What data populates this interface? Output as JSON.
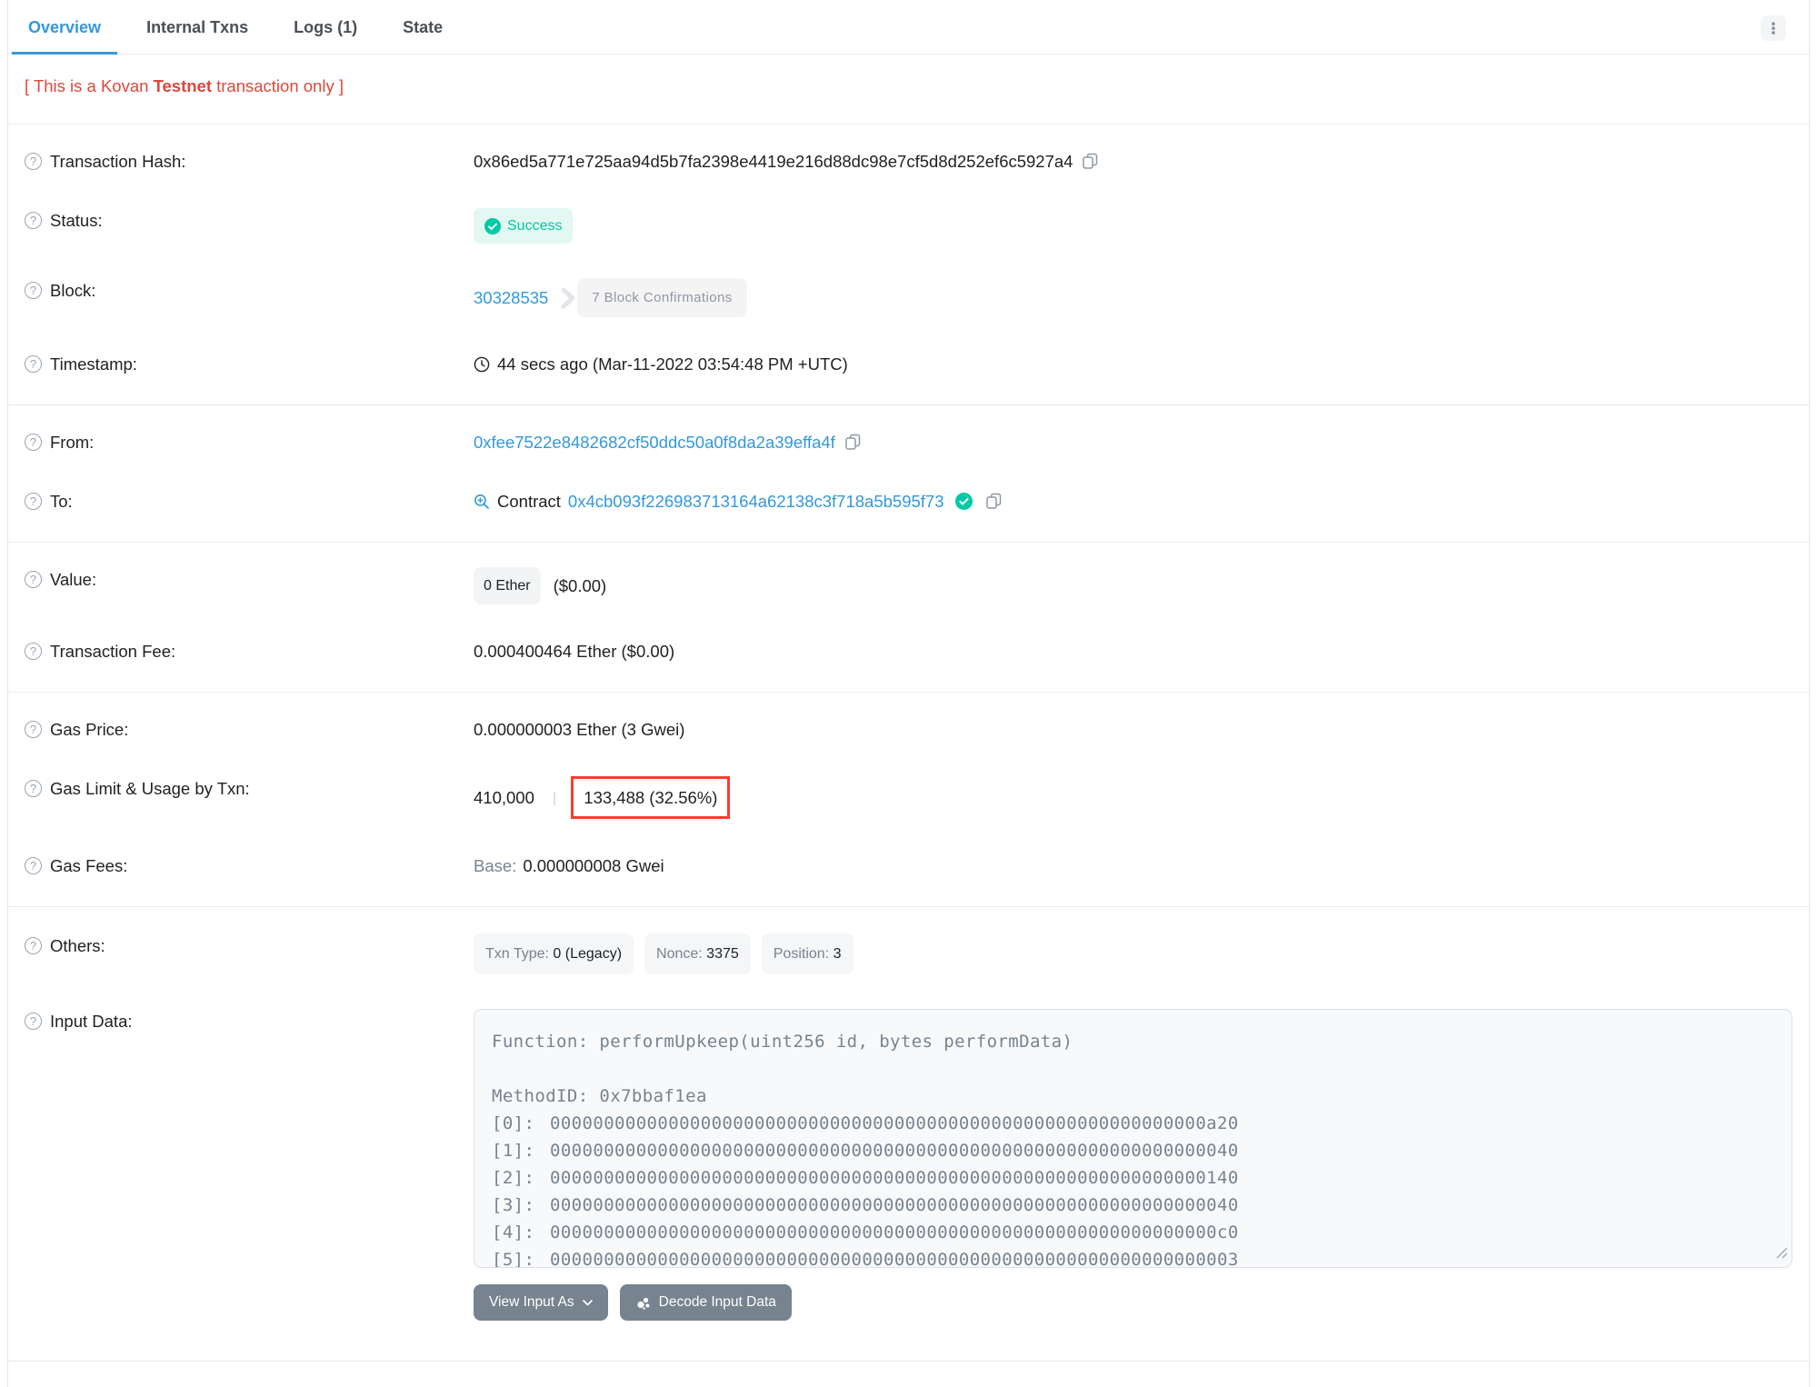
{
  "colors": {
    "accent_blue": "#3498db",
    "success_teal": "#00c9a7",
    "notice_red": "#e0473d",
    "highlight_red": "#ff3b30",
    "divider": "#e7eaf3",
    "muted": "#77838f"
  },
  "tabs": {
    "overview": "Overview",
    "internal": "Internal Txns",
    "logs": "Logs (1)",
    "state": "State"
  },
  "menu": {
    "kebab_glyph": "⋮"
  },
  "notice": {
    "part1": "[ This is a Kovan ",
    "bold": "Testnet",
    "part2": " transaction only ]"
  },
  "rows": {
    "hash": {
      "label": "Transaction Hash:",
      "value": "0x86ed5a771e725aa94d5b7fa2398e4419e216d88dc98e7cf5d8d252ef6c5927a4"
    },
    "status": {
      "label": "Status:",
      "badge": "Success",
      "check_glyph": "✓"
    },
    "block": {
      "label": "Block:",
      "number": "30328535",
      "confirmations": "7 Block Confirmations"
    },
    "timestamp": {
      "label": "Timestamp:",
      "value": "44 secs ago (Mar-11-2022 03:54:48 PM +UTC)"
    },
    "from": {
      "label": "From:",
      "address": "0xfee7522e8482682cf50ddc50a0f8da2a39effa4f"
    },
    "to": {
      "label": "To:",
      "kind": "Contract",
      "address": "0x4cb093f226983713164a62138c3f718a5b595f73",
      "check_glyph": "✓"
    },
    "value": {
      "label": "Value:",
      "amount": "0 Ether",
      "usd": "($0.00)"
    },
    "fee": {
      "label": "Transaction Fee:",
      "value": "0.000400464 Ether ($0.00)"
    },
    "gas_price": {
      "label": "Gas Price:",
      "value": "0.000000003 Ether (3 Gwei)"
    },
    "gas_limit": {
      "label": "Gas Limit & Usage by Txn:",
      "limit": "410,000",
      "separator": "|",
      "usage": "133,488 (32.56%)"
    },
    "gas_fees": {
      "label": "Gas Fees:",
      "base_label": "Base:",
      "base_value": "0.000000008 Gwei"
    },
    "others": {
      "label": "Others:",
      "txn_type_label": "Txn Type:",
      "txn_type_value": "0 (Legacy)",
      "nonce_label": "Nonce:",
      "nonce_value": "3375",
      "position_label": "Position:",
      "position_value": "3"
    },
    "input": {
      "label": "Input Data:",
      "function_line": "Function: performUpkeep(uint256 id, bytes performData)",
      "method_line": "MethodID: 0x7bbaf1ea",
      "params": [
        {
          "key": "[0]:",
          "value": "0000000000000000000000000000000000000000000000000000000000000a20"
        },
        {
          "key": "[1]:",
          "value": "0000000000000000000000000000000000000000000000000000000000000040"
        },
        {
          "key": "[2]:",
          "value": "0000000000000000000000000000000000000000000000000000000000000140"
        },
        {
          "key": "[3]:",
          "value": "0000000000000000000000000000000000000000000000000000000000000040"
        },
        {
          "key": "[4]:",
          "value": "00000000000000000000000000000000000000000000000000000000000000c0"
        },
        {
          "key": "[5]:",
          "value": "0000000000000000000000000000000000000000000000000000000000000003"
        }
      ],
      "view_as_button": "View Input As",
      "decode_button": "Decode Input Data"
    }
  }
}
